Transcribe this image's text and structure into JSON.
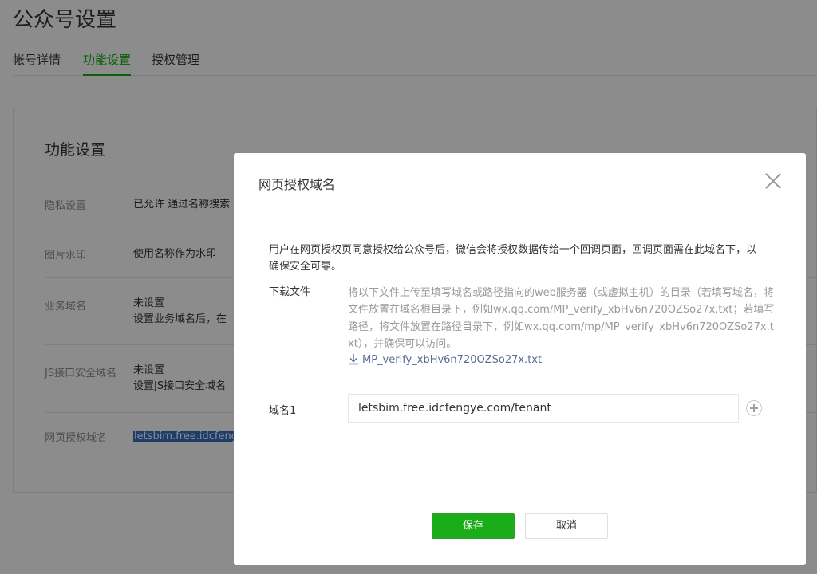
{
  "header": {
    "title": "公众号设置"
  },
  "tabs": [
    {
      "label": "帐号详情"
    },
    {
      "label": "功能设置"
    },
    {
      "label": "授权管理"
    }
  ],
  "settings": {
    "title": "功能设置",
    "rows": [
      {
        "label": "隐私设置",
        "value": "已允许 通过名称搜索"
      },
      {
        "label": "图片水印",
        "value": "使用名称作为水印"
      },
      {
        "label": "业务域名",
        "value": "未设置",
        "note": "设置业务域名后，在"
      },
      {
        "label": "JS接口安全域名",
        "value": "未设置",
        "note": "设置JS接口安全域名"
      },
      {
        "label": "网页授权域名",
        "value": "letsbim.free.idcfeng"
      }
    ]
  },
  "dialog": {
    "title": "网页授权域名",
    "intro": "用户在网页授权页同意授权给公众号后，微信会将授权数据传给一个回调页面，回调页面需在此域名下，以确保安全可靠。",
    "download_label": "下载文件",
    "download_desc": "将以下文件上传至填写域名或路径指向的web服务器（或虚拟主机）的目录（若填写域名，将文件放置在域名根目录下，例如wx.qq.com/MP_verify_xbHv6n720OZSo27x.txt；若填写路径，将文件放置在路径目录下，例如wx.qq.com/mp/MP_verify_xbHv6n720OZSo27x.txt），并确保可以访问。",
    "download_file": "MP_verify_xbHv6n720OZSo27x.txt",
    "domain_label": "域名1",
    "domain_value": "letsbim.free.idcfengye.com/tenant",
    "save_label": "保存",
    "cancel_label": "取消"
  },
  "colors": {
    "accent": "#1aad19",
    "link": "#576b95",
    "selection": "#3a6fc4"
  },
  "icons": {
    "close": "close-icon",
    "download": "download-icon",
    "add": "plus-circle-icon"
  }
}
